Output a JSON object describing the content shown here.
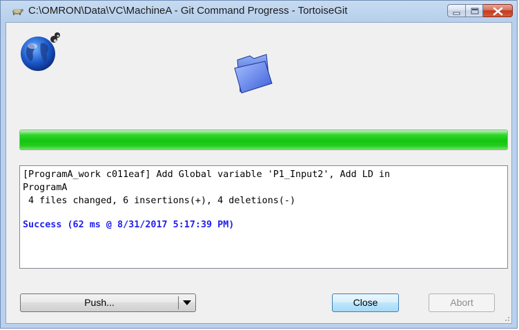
{
  "window": {
    "title": "C:\\OMRON\\Data\\VC\\MachineA - Git Command Progress - TortoiseGit",
    "icon": "tortoisegit-app-icon",
    "caption_buttons": [
      "minimize-icon",
      "maximize-icon",
      "close-icon"
    ]
  },
  "graphics": {
    "globe": "globe-network-icon",
    "folder": "folder-icon"
  },
  "progress": {
    "percent": 100,
    "color": "#14c410"
  },
  "log": {
    "lines": [
      "[ProgramA_work c011eaf] Add Global variable 'P1_Input2', Add LD in",
      "ProgramA",
      " 4 files changed, 6 insertions(+), 4 deletions(-)"
    ],
    "success_line": "Success (62 ms @ 8/31/2017 5:17:39 PM)",
    "success_color": "#2020f0"
  },
  "buttons": {
    "push_label": "Push...",
    "close_label": "Close",
    "abort_label": "Abort"
  }
}
